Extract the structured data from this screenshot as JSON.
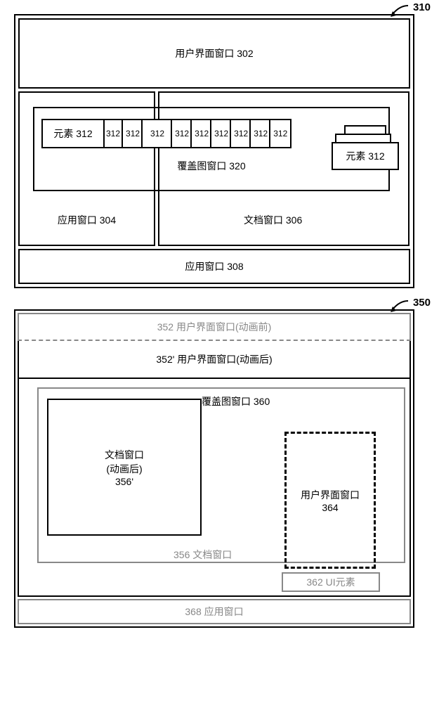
{
  "fig310": {
    "ref": "310",
    "ui_window_302": "用户界面窗口  302",
    "element_312_main": "元素 312",
    "elements_312": [
      "312",
      "312",
      "312",
      "312",
      "312",
      "312",
      "312",
      "312",
      "312"
    ],
    "element_312_tail": "元素 312",
    "overlay_320": "覆盖图窗口  320",
    "app_window_304": "应用窗口  304",
    "doc_window_306": "文档窗口  306",
    "app_window_308": "应用窗口  308"
  },
  "fig350": {
    "ref": "350",
    "ui_352": "352 用户界面窗口(动画前)",
    "ui_352p": "352' 用户界面窗口(动画后)",
    "overlay_360": "覆盖图窗口  360",
    "doc_356p_l1": "文档窗口",
    "doc_356p_l2": "(动画后)",
    "doc_356p_l3": "356'",
    "doc_356": "356 文档窗口",
    "ui_364_l1": "用户界面窗口",
    "ui_364_l2": "364",
    "ui_362": "362  UI元素",
    "app_368": "368 应用窗口"
  }
}
